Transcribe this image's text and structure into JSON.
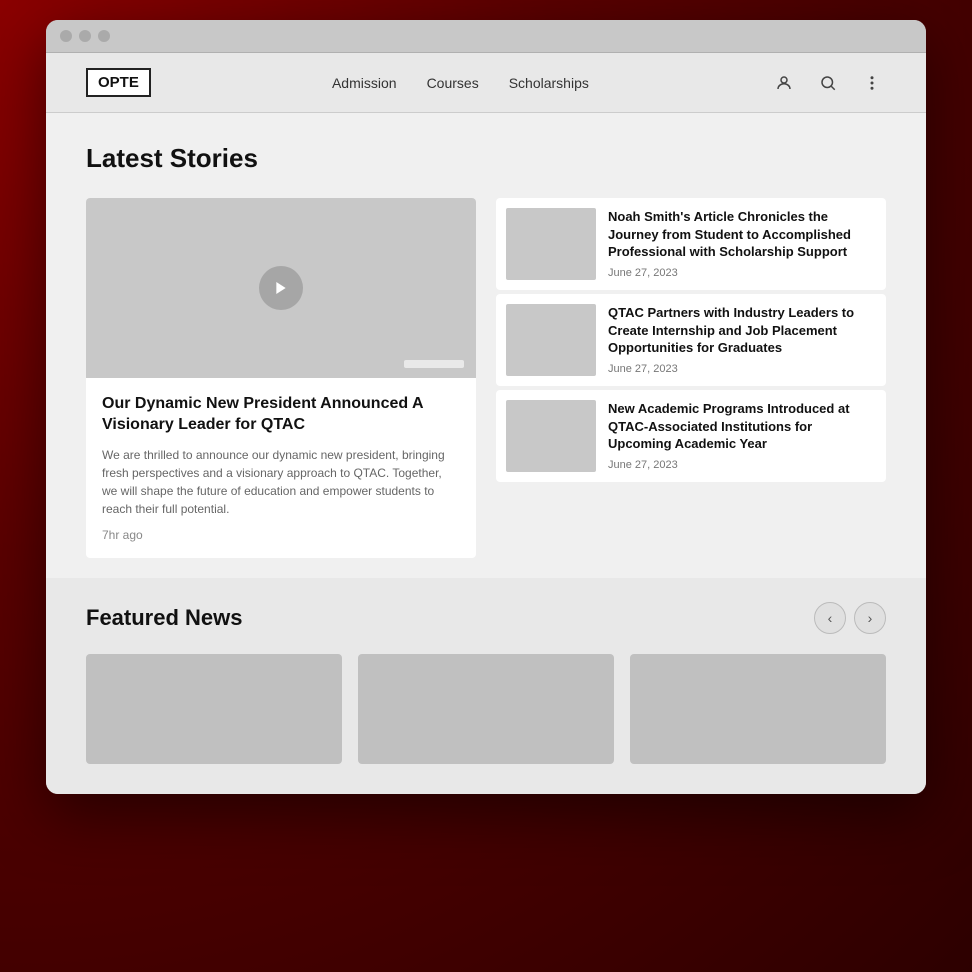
{
  "browser": {
    "traffic_lights": [
      "close",
      "minimize",
      "maximize"
    ]
  },
  "navbar": {
    "logo": "OPTE",
    "links": [
      {
        "id": "admission",
        "label": "Admission"
      },
      {
        "id": "courses",
        "label": "Courses"
      },
      {
        "id": "scholarships",
        "label": "Scholarships"
      }
    ],
    "icons": {
      "user": "👤",
      "search": "🔍",
      "menu": "⋮"
    }
  },
  "latest_stories": {
    "section_title": "Latest Stories",
    "featured": {
      "title": "Our Dynamic New President Announced A Visionary Leader for QTAC",
      "description": "We are thrilled to announce our dynamic new president, bringing fresh perspectives and a visionary approach to QTAC. Together, we will shape the future of education and empower students to reach their full potential.",
      "time": "7hr ago"
    },
    "side_articles": [
      {
        "id": "article-1",
        "title": "Noah Smith's Article Chronicles the Journey from Student to Accomplished Professional with Scholarship Support",
        "date": "June 27, 2023"
      },
      {
        "id": "article-2",
        "title": "QTAC Partners with Industry Leaders to Create Internship and Job Placement Opportunities for Graduates",
        "date": "June 27, 2023"
      },
      {
        "id": "article-3",
        "title": "New Academic Programs Introduced at QTAC-Associated Institutions for Upcoming Academic Year",
        "date": "June 27, 2023"
      }
    ]
  },
  "featured_news": {
    "section_title": "Featured News",
    "prev_label": "‹",
    "next_label": "›",
    "cards": [
      {
        "id": "news-1"
      },
      {
        "id": "news-2"
      },
      {
        "id": "news-3"
      }
    ]
  }
}
